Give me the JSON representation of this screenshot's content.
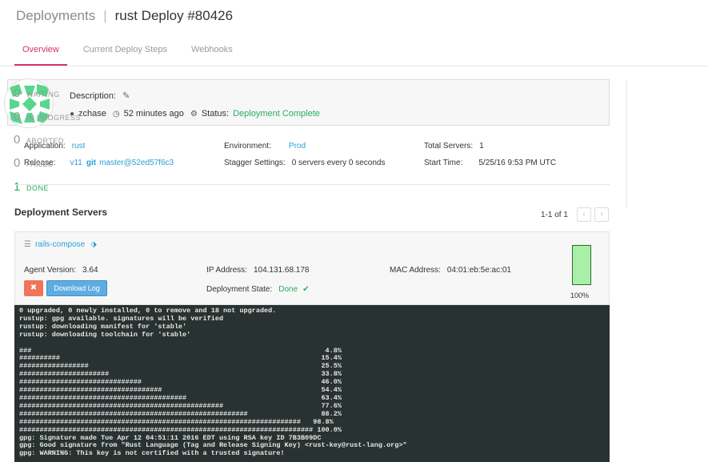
{
  "header": {
    "breadcrumb": "Deployments",
    "separator": "|",
    "title": "rust Deploy #80426"
  },
  "tabs": [
    {
      "label": "Overview",
      "active": true
    },
    {
      "label": "Current Deploy Steps",
      "active": false
    },
    {
      "label": "Webhooks",
      "active": false
    }
  ],
  "description": {
    "label": "Description:",
    "user": "zchase",
    "time_ago": "52 minutes ago",
    "status_label": "Status:",
    "status_value": "Deployment Complete"
  },
  "info": {
    "application_label": "Application:",
    "application_value": "rust",
    "release_label": "Release:",
    "release_version": "v11",
    "git_label": "git",
    "release_ref": "master@52ed57f6c3",
    "environment_label": "Environment:",
    "environment_value": "Prod",
    "stagger_label": "Stagger Settings:",
    "stagger_value": "0 servers every 0 seconds",
    "total_servers_label": "Total Servers:",
    "total_servers_value": "1",
    "start_time_label": "Start Time:",
    "start_time_value": "5/25/16 9:53 PM UTC"
  },
  "status_counts": [
    {
      "count": "0",
      "label": "WAITING"
    },
    {
      "count": "0",
      "label": "IN PROGRESS"
    },
    {
      "count": "0",
      "label": "ABORTED"
    },
    {
      "count": "0",
      "label": "FAILED"
    },
    {
      "count": "1",
      "label": "DONE"
    }
  ],
  "servers": {
    "section_title": "Deployment Servers",
    "pager_text": "1-1 of 1",
    "prev_icon": "chevron-left-icon",
    "next_icon": "chevron-right-icon"
  },
  "server": {
    "name": "rails-compose",
    "agent_version_label": "Agent Version:",
    "agent_version_value": "3.64",
    "ip_label": "IP Address:",
    "ip_value": "104.131.68.178",
    "mac_label": "MAC Address:",
    "mac_value": "04:01:eb:5e:ac:01",
    "state_label": "Deployment State:",
    "state_value": "Done",
    "abort_symbol": "✖",
    "download_label": "Download Log",
    "progress_fraction": 1.0,
    "progress_text": "100%"
  },
  "log_lines": [
    "0 upgraded, 0 newly installed, 0 to remove and 18 not upgraded.",
    "rustup: gpg available. signatures will be verified",
    "rustup: downloading manifest for 'stable'",
    "rustup: downloading toolchain for 'stable'",
    "",
    "###                                                                        4.8%",
    "##########                                                                15.4%",
    "#################                                                         25.5%",
    "######################                                                    33.8%",
    "##############################                                            46.0%",
    "###################################                                       54.4%",
    "#########################################                                 63.4%",
    "##################################################                        77.6%",
    "########################################################                  88.2%",
    "#####################################################################   98.8%",
    "######################################################################## 100.0%",
    "gpg: Signature made Tue Apr 12 04:51:11 2016 EDT using RSA key ID 7B3B09DC",
    "gpg: Good signature from \"Rust Language (Tag and Release Signing Key) <rust-key@rust-lang.org>\"",
    "gpg: WARNING: This key is not certified with a trusted signature!"
  ],
  "colors": {
    "accent_tab": "#d6336c",
    "link": "#2a9fd6",
    "success": "#27ae60",
    "terminal_bg": "#283230",
    "abort_button": "#f0735a",
    "download_button": "#5dade2"
  }
}
